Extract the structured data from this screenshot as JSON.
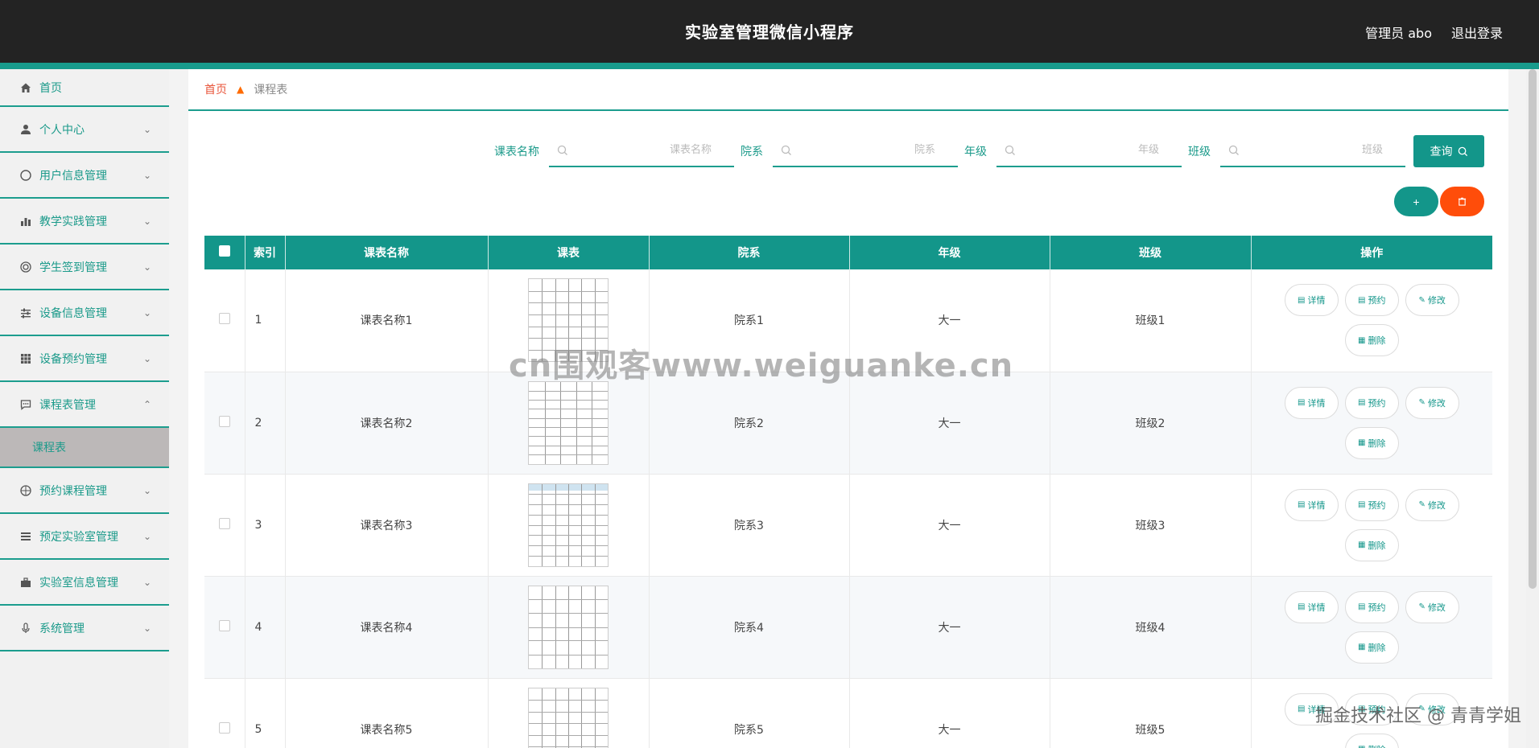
{
  "app": {
    "title": "实验室管理微信小程序",
    "user_label": "管理员 abo",
    "logout_label": "退出登录"
  },
  "sidebar": {
    "items": [
      {
        "label": "首页",
        "icon": "home-icon"
      },
      {
        "label": "个人中心",
        "icon": "user-icon"
      },
      {
        "label": "用户信息管理",
        "icon": "compass-icon"
      },
      {
        "label": "教学实践管理",
        "icon": "bar-chart-icon"
      },
      {
        "label": "学生签到管理",
        "icon": "target-icon"
      },
      {
        "label": "设备信息管理",
        "icon": "sliders-icon"
      },
      {
        "label": "设备预约管理",
        "icon": "grid-icon"
      },
      {
        "label": "课程表管理",
        "icon": "chat-icon"
      },
      {
        "label": "预约课程管理",
        "icon": "compass-icon"
      },
      {
        "label": "预定实验室管理",
        "icon": "list-icon"
      },
      {
        "label": "实验室信息管理",
        "icon": "briefcase-icon"
      },
      {
        "label": "系统管理",
        "icon": "mic-icon"
      }
    ],
    "submenu": {
      "label": "课程表"
    }
  },
  "breadcrumb": {
    "home": "首页",
    "current": "课程表"
  },
  "search": {
    "fields": [
      {
        "label": "课表名称",
        "placeholder": "课表名称"
      },
      {
        "label": "院系",
        "placeholder": "院系"
      },
      {
        "label": "年级",
        "placeholder": "年级"
      },
      {
        "label": "班级",
        "placeholder": "班级"
      }
    ],
    "query_label": "查询"
  },
  "actions": {
    "add_label": "+",
    "delete_icon": "trash-icon"
  },
  "table": {
    "headers": [
      "",
      "索引",
      "课表名称",
      "课表",
      "院系",
      "年级",
      "班级",
      "操作"
    ],
    "rows": [
      {
        "index": "1",
        "name": "课表名称1",
        "dept": "院系1",
        "grade": "大一",
        "class": "班级1"
      },
      {
        "index": "2",
        "name": "课表名称2",
        "dept": "院系2",
        "grade": "大一",
        "class": "班级2"
      },
      {
        "index": "3",
        "name": "课表名称3",
        "dept": "院系3",
        "grade": "大一",
        "class": "班级3"
      },
      {
        "index": "4",
        "name": "课表名称4",
        "dept": "院系4",
        "grade": "大一",
        "class": "班级4"
      },
      {
        "index": "5",
        "name": "课表名称5",
        "dept": "院系5",
        "grade": "大一",
        "class": "班级5"
      }
    ],
    "op_labels": {
      "detail": "详情",
      "reserve": "预约",
      "edit": "修改",
      "delete": "删除"
    }
  },
  "watermarks": {
    "center": "cn围观客www.weiguanke.cn",
    "corner": "掘金技术社区 @ 青青学姐"
  },
  "colors": {
    "accent": "#13968a",
    "danger": "#ff4d0a",
    "topbar": "#232323"
  }
}
